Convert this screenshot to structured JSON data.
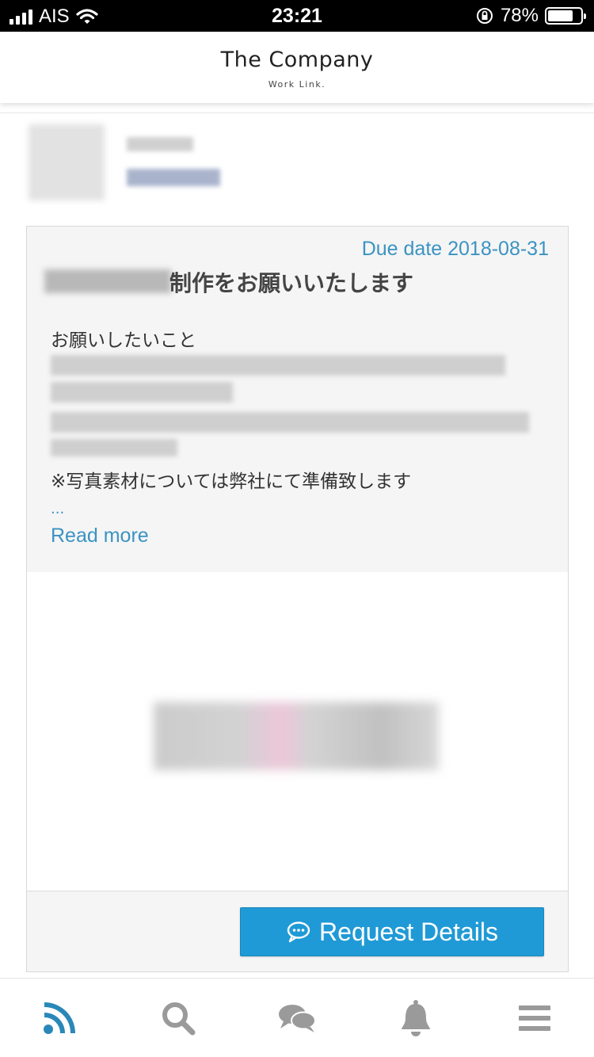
{
  "status_bar": {
    "carrier": "AIS",
    "time": "23:21",
    "battery_percent": "78%",
    "battery_level": 0.78
  },
  "header": {
    "brand_name": "The Company",
    "brand_tagline": "Work Link."
  },
  "job": {
    "due_date": "Due date 2018-08-31",
    "title": "制作をお願いいたします",
    "body_label": "お願いしたいこと",
    "body_note": "※写真素材については弊社にて準備致します",
    "ellipsis": "...",
    "read_more": "Read more",
    "request_button": "Request Details"
  },
  "colors": {
    "accent": "#3b93c1",
    "button": "#1f9ad6",
    "nav_active": "#2a88b8",
    "nav_inactive": "#9a9a9a"
  },
  "nav": {
    "items": [
      {
        "icon": "rss-feed-icon",
        "active": true
      },
      {
        "icon": "search-icon",
        "active": false
      },
      {
        "icon": "chat-bubbles-icon",
        "active": false
      },
      {
        "icon": "bell-icon",
        "active": false
      },
      {
        "icon": "menu-icon",
        "active": false
      }
    ]
  }
}
